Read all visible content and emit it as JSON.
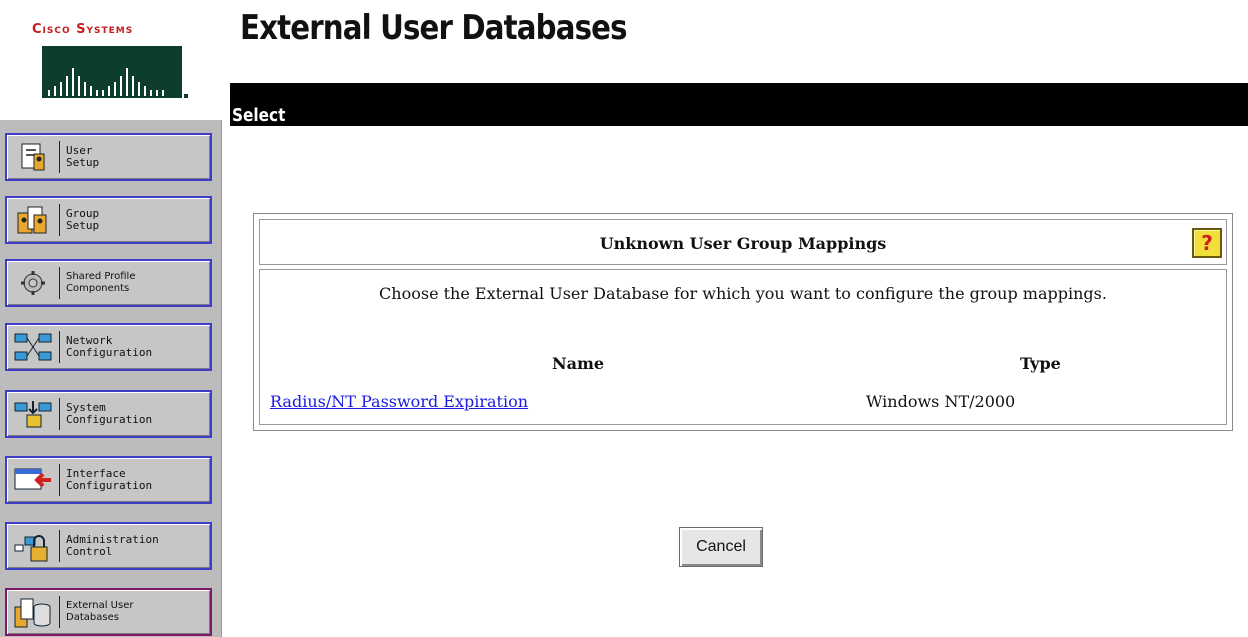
{
  "brand": {
    "name": "Cisco Systems",
    "accent": "#c41e1e"
  },
  "header": {
    "title": "External User Databases",
    "section": "Select"
  },
  "sidebar": {
    "items": [
      {
        "label": "User\nSetup",
        "icon": "user-setup-icon"
      },
      {
        "label": "Group\nSetup",
        "icon": "group-setup-icon"
      },
      {
        "label": "Shared Profile\nComponents",
        "icon": "shared-profile-icon"
      },
      {
        "label": "Network\nConfiguration",
        "icon": "network-config-icon"
      },
      {
        "label": "System\nConfiguration",
        "icon": "system-config-icon"
      },
      {
        "label": "Interface\nConfiguration",
        "icon": "interface-config-icon"
      },
      {
        "label": "Administration\nControl",
        "icon": "admin-control-icon"
      },
      {
        "label": "External User\nDatabases",
        "icon": "external-db-icon",
        "active": true
      }
    ]
  },
  "mapping": {
    "title": "Unknown User Group Mappings",
    "help_label": "?",
    "description": "Choose the External User Database for which you want to configure the group mappings.",
    "columns": {
      "name": "Name",
      "type": "Type"
    },
    "rows": [
      {
        "name": "Radius/NT Password Expiration",
        "type": "Windows NT/2000"
      }
    ]
  },
  "actions": {
    "cancel_label": "Cancel"
  }
}
